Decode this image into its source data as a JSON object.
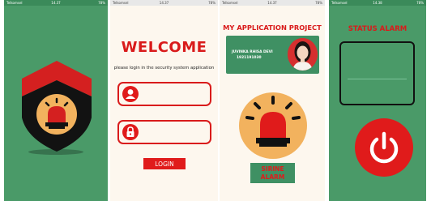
{
  "status_bar": {
    "screen1": {
      "left": "Telkomsel",
      "center": "14.37",
      "right": "78%"
    },
    "screen2": {
      "left": "Telkomsel",
      "center": "14.37",
      "right": "78%"
    },
    "screen3": {
      "left": "Telkomsel",
      "center": "14.37",
      "right": "78%"
    },
    "screen4": {
      "left": "Telkomsel",
      "center": "14.38",
      "right": "78%"
    }
  },
  "login": {
    "title": "WELCOME",
    "subtitle": "please login in the security system application",
    "username_value": "",
    "password_value": "",
    "button_label": "LOGIN"
  },
  "project": {
    "title": "MY APPLICATION PROJECT",
    "name": "JUVINKA RHISA DEVI",
    "student_id": "1921191030",
    "sirine_line1": "SIRINE",
    "sirine_line2": "ALARM"
  },
  "status": {
    "title": "STATUS ALARM",
    "display_value": ""
  },
  "colors": {
    "brand_green": "#4a9a68",
    "alert_red": "#e01b1b",
    "siren_orange": "#f2b25e",
    "cream": "#fdf7ee"
  },
  "icons": [
    "alarm-shield-icon",
    "user-icon",
    "lock-icon",
    "siren-icon",
    "power-icon"
  ]
}
